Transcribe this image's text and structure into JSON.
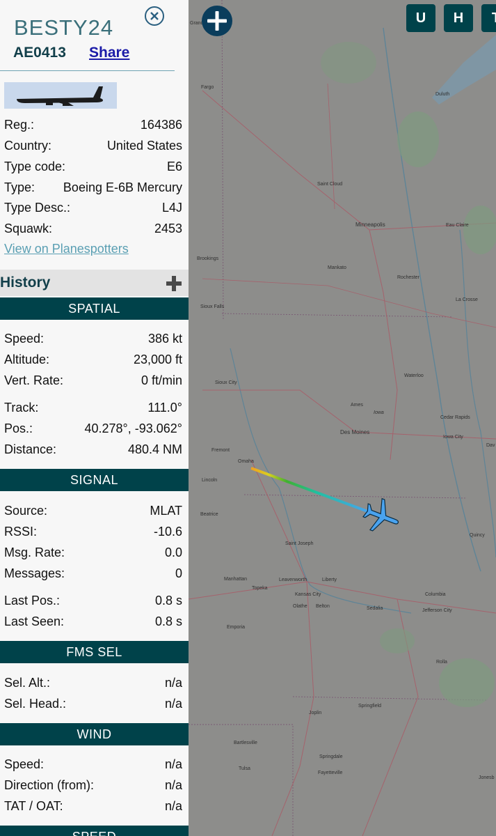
{
  "aircraft": {
    "callsign": "BESTY24",
    "hex": "AE0413",
    "share_label": "Share",
    "planespotters_link": "View on Planespotters"
  },
  "details": [
    {
      "label": "Reg.:",
      "value": "164386"
    },
    {
      "label": "Country:",
      "value": "United States"
    },
    {
      "label": "Type code:",
      "value": "E6"
    },
    {
      "label": "Type:",
      "value": "Boeing E-6B Mercury"
    },
    {
      "label": "Type Desc.:",
      "value": "L4J"
    },
    {
      "label": "Squawk:",
      "value": "2453"
    }
  ],
  "history": {
    "label": "History"
  },
  "sections": {
    "spatial": {
      "title": "SPATIAL",
      "rows": [
        {
          "label": "Speed:",
          "value": "386 kt"
        },
        {
          "label": "Altitude:",
          "value": "23,000 ft"
        },
        {
          "label": "Vert. Rate:",
          "value": "0 ft/min"
        },
        {
          "label": "Track:",
          "value": "111.0°"
        },
        {
          "label": "Pos.:",
          "value": "40.278°, -93.062°"
        },
        {
          "label": "Distance:",
          "value": "480.4 NM"
        }
      ]
    },
    "signal": {
      "title": "SIGNAL",
      "rows": [
        {
          "label": "Source:",
          "value": "MLAT"
        },
        {
          "label": "RSSI:",
          "value": "-10.6"
        },
        {
          "label": "Msg. Rate:",
          "value": "0.0"
        },
        {
          "label": "Messages:",
          "value": "0"
        },
        {
          "label": "Last Pos.:",
          "value": "0.8 s"
        },
        {
          "label": "Last Seen:",
          "value": "0.8 s"
        }
      ]
    },
    "fms": {
      "title": "FMS SEL",
      "rows": [
        {
          "label": "Sel. Alt.:",
          "value": "n/a"
        },
        {
          "label": "Sel. Head.:",
          "value": "n/a"
        }
      ]
    },
    "wind": {
      "title": "WIND",
      "rows": [
        {
          "label": "Speed:",
          "value": "n/a"
        },
        {
          "label": "Direction (from):",
          "value": "n/a"
        },
        {
          "label": "TAT / OAT:",
          "value": "n/a"
        }
      ]
    },
    "speed": {
      "title": "SPEED"
    }
  },
  "map": {
    "buttons": [
      "U",
      "H",
      "T"
    ],
    "cities": [
      "Fargo",
      "Duluth",
      "Saint Cloud",
      "Minneapolis",
      "Eau Claire",
      "Brookings",
      "Mankato",
      "Rochester",
      "La Crosse",
      "Sioux Falls",
      "Sioux City",
      "Waterloo",
      "Ames",
      "Iowa",
      "Cedar Rapids",
      "Iowa City",
      "Des Moines",
      "Fremont",
      "Omaha",
      "Lincoln",
      "Beatrice",
      "Quincy",
      "Saint Joseph",
      "Manhattan",
      "Topeka",
      "Leavenworth",
      "Liberty",
      "Kansas City",
      "Olathe",
      "Belton",
      "Sedalia",
      "Columbia",
      "Jefferson City",
      "Emporia",
      "Rolla",
      "Joplin",
      "Springfield",
      "Bartlesville",
      "Tulsa",
      "Springdale",
      "Fayetteville",
      "Jonesb",
      "Grand",
      "Dav"
    ],
    "colors": {
      "aircraft": "#4aa3ef",
      "panel": "#00424a"
    }
  }
}
